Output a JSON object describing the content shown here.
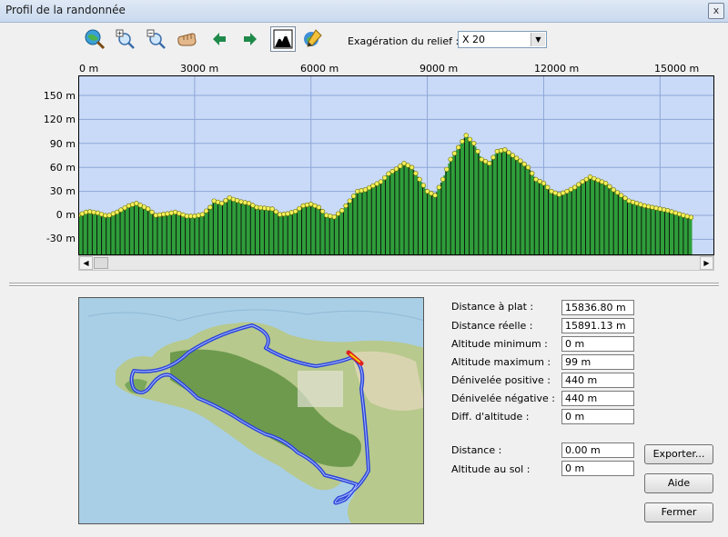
{
  "window": {
    "title": "Profil de la randonnée",
    "close_glyph": "x"
  },
  "toolbar": {
    "icons": [
      "globe-zoom-icon",
      "zoom-in-icon",
      "zoom-out-icon",
      "pan-hand-icon",
      "arrow-left-icon",
      "arrow-right-icon",
      "terrain-profile-icon",
      "map-pencil-icon"
    ],
    "exaggeration_label": "Exagération du relief :",
    "exaggeration_value": "X 20"
  },
  "chart_data": {
    "type": "area",
    "title": "",
    "xlabel": "",
    "ylabel": "",
    "x_ticks": [
      "0 m",
      "3000 m",
      "6000 m",
      "9000 m",
      "12000 m",
      "15000 m"
    ],
    "y_ticks": [
      "150 m",
      "120 m",
      "90 m",
      "60 m",
      "30 m",
      "0 m",
      "-30 m"
    ],
    "xlim": [
      0,
      16400
    ],
    "ylim": [
      -50,
      175
    ],
    "series": [
      {
        "x": [
          0,
          250,
          500,
          750,
          1000,
          1300,
          1500,
          1800,
          2000,
          2300,
          2500,
          2800,
          3000,
          3200,
          3400,
          3500,
          3700,
          3900,
          4000,
          4200,
          4400,
          4600,
          4800,
          5000,
          5200,
          5400,
          5600,
          5800,
          6000,
          6200,
          6400,
          6600,
          6800,
          7000,
          7200,
          7400,
          7600,
          7800,
          8000,
          8200,
          8400,
          8600,
          8800,
          9000,
          9200,
          9400,
          9600,
          9800,
          10000,
          10200,
          10400,
          10600,
          10800,
          11000,
          11200,
          11400,
          11600,
          11800,
          12000,
          12200,
          12400,
          12600,
          12800,
          13000,
          13200,
          13400,
          13600,
          13800,
          14000,
          14200,
          14400,
          14600,
          14800,
          15000,
          15200,
          15400,
          15600,
          15836
        ],
        "y": [
          0,
          5,
          3,
          -1,
          4,
          12,
          15,
          8,
          0,
          2,
          4,
          -1,
          -1,
          1,
          10,
          18,
          15,
          22,
          20,
          17,
          15,
          10,
          9,
          8,
          1,
          2,
          5,
          12,
          14,
          10,
          0,
          -2,
          6,
          18,
          30,
          32,
          37,
          42,
          52,
          58,
          65,
          60,
          45,
          30,
          25,
          45,
          70,
          85,
          100,
          90,
          70,
          65,
          80,
          82,
          75,
          68,
          60,
          45,
          40,
          30,
          26,
          30,
          35,
          42,
          48,
          44,
          40,
          32,
          25,
          18,
          15,
          12,
          10,
          8,
          6,
          3,
          0,
          -3
        ],
        "color": "#2f9e3a"
      }
    ]
  },
  "stats": [
    {
      "label": "Distance à plat :",
      "value": "15836.80 m"
    },
    {
      "label": "Distance réelle :",
      "value": "15891.13 m"
    },
    {
      "label": "Altitude minimum :",
      "value": "0 m"
    },
    {
      "label": "Altitude maximum :",
      "value": "99 m"
    },
    {
      "label": "Dénivelée positive :",
      "value": "440 m"
    },
    {
      "label": "Dénivelée négative :",
      "value": "440 m"
    },
    {
      "label": "Diff. d'altitude :",
      "value": "0 m"
    }
  ],
  "cursor": [
    {
      "label": "Distance :",
      "value": "0.00 m"
    },
    {
      "label": "Altitude au sol :",
      "value": "0 m"
    }
  ],
  "buttons": {
    "export": "Exporter...",
    "help": "Aide",
    "close": "Fermer"
  },
  "map": {
    "description_icon": "topographic-map-route"
  }
}
